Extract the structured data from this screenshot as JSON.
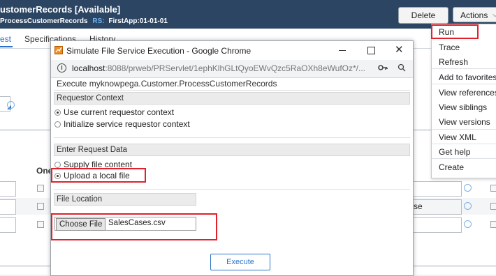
{
  "header": {
    "title": "ustomerRecords [Available]",
    "subtitle_name": "ProcessCustomerRecords",
    "rs_label": "RS:",
    "ruleset": "FirstApp:01-01-01",
    "delete_label": "Delete",
    "actions_label": "Actions"
  },
  "tabs": [
    "est",
    "Specifications",
    "History"
  ],
  "background": {
    "column_header": "One",
    "row_partial_text": "se"
  },
  "actions_menu": {
    "items": [
      "Run",
      "Trace",
      "Refresh",
      "Add to favorites",
      "View references",
      "View siblings",
      "View versions",
      "View XML",
      "Get help",
      "Create"
    ],
    "highlighted": "Run"
  },
  "dialog": {
    "window_title": "Simulate File Service Execution - Google Chrome",
    "url_host": "localhost",
    "url_rest": ":8088/prweb/PRServlet/1ephKlhGLtQyoEWvQzc5RaOXh8eWufOz*/...",
    "exec_heading": "Execute myknowpega.Customer.ProcessCustomerRecords",
    "requestor_section": "Requestor Context",
    "requestor_options": [
      "Use current requestor context",
      "Initialize service requestor context"
    ],
    "request_section": "Enter Request Data",
    "request_options": [
      "Supply file content",
      "Upload a local file"
    ],
    "file_location_label": "File Location",
    "choose_file_label": "Choose File",
    "file_name": "SalesCases.csv",
    "execute_label": "Execute"
  },
  "colors": {
    "header_bg": "#2b4563",
    "accent": "#2a73c8",
    "highlight_box": "#e0202a"
  }
}
